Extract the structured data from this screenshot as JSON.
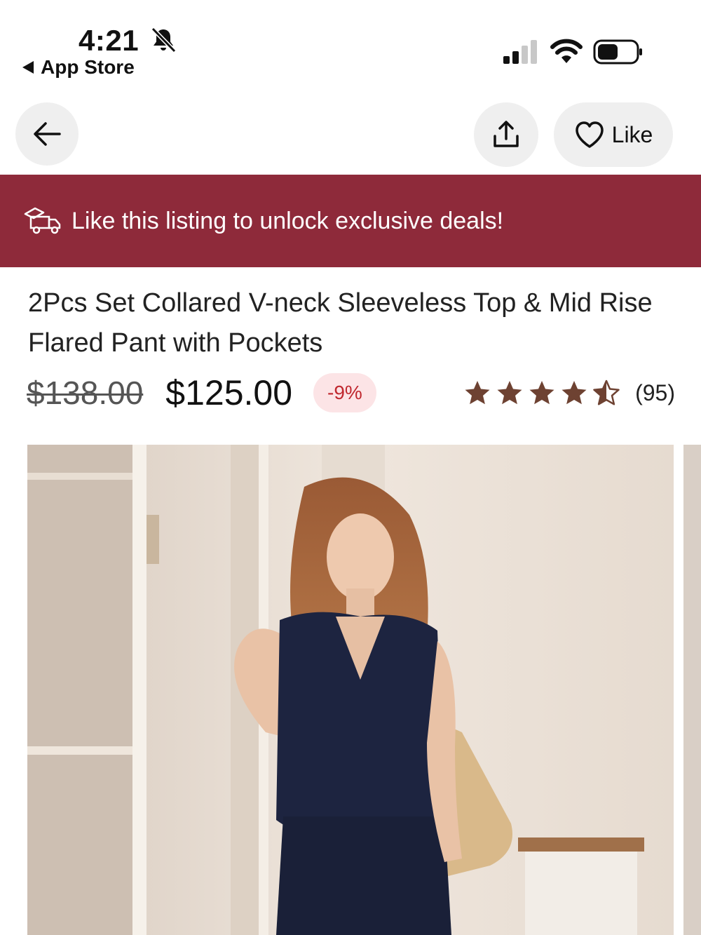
{
  "status_bar": {
    "time": "4:21",
    "back_app_label": "App Store"
  },
  "header": {
    "like_label": "Like"
  },
  "banner": {
    "text": "Like this listing to unlock exclusive deals!",
    "background": "#8e2a3a"
  },
  "product": {
    "title": "2Pcs Set Collared V-neck Sleeveless Top & Mid Rise Flared Pant with Pockets",
    "old_price": "$138.00",
    "price": "$125.00",
    "discount": "-9%",
    "rating": 4.5,
    "review_count": "(95)",
    "star_color": "#6e4232"
  },
  "icons": {
    "bell": "bell-slash-icon",
    "back": "arrow-left-icon",
    "share": "share-icon",
    "like": "heart-icon",
    "banner": "delivery-truck-icon"
  }
}
